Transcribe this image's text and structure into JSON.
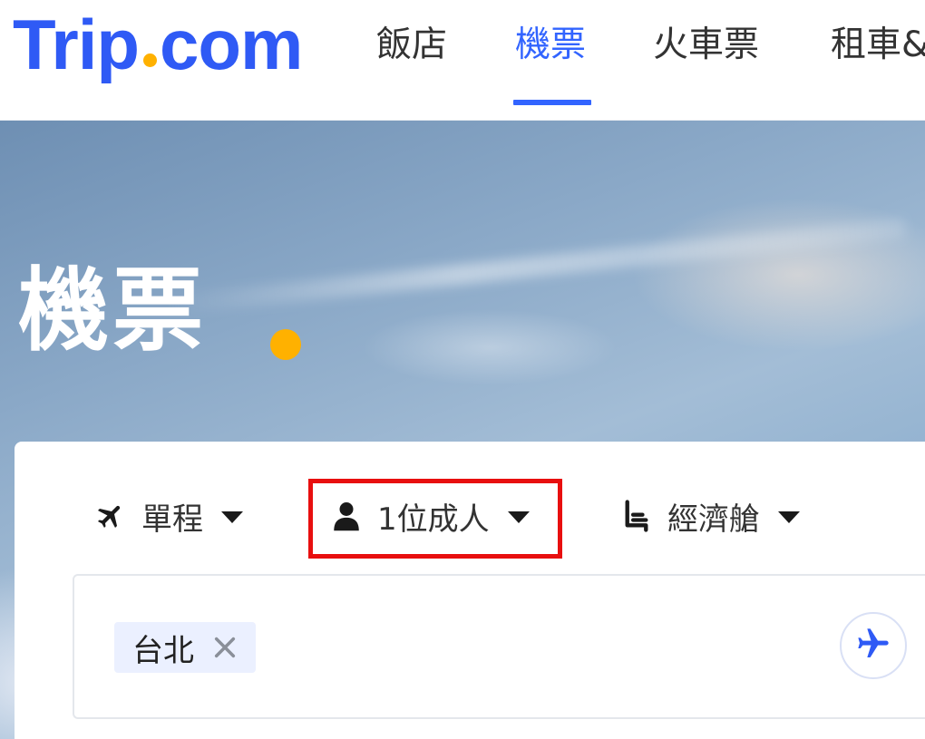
{
  "header": {
    "logo": {
      "left_text": "Trip",
      "right_text": "com"
    },
    "nav_tabs": [
      {
        "label": "飯店",
        "active": false
      },
      {
        "label": "機票",
        "active": true
      },
      {
        "label": "火車票",
        "active": false
      },
      {
        "label": "租車&",
        "active": false
      }
    ]
  },
  "hero": {
    "title": "機票"
  },
  "search": {
    "trip_type": {
      "label": "單程",
      "icon": "airplane-icon"
    },
    "passengers": {
      "label": "1位成人",
      "icon": "person-icon"
    },
    "cabin_class": {
      "label": "經濟艙",
      "icon": "seat-icon"
    },
    "origin_city": {
      "label": "台北",
      "remove_icon": "close-icon"
    },
    "destination_action_icon": "airplane-icon"
  },
  "colors": {
    "brand_blue": "#2f5af5",
    "accent_yellow": "#ffb100",
    "active_tab": "#3264ff",
    "highlight_red": "#e80f0f",
    "chip_background": "#ebf0ff"
  }
}
